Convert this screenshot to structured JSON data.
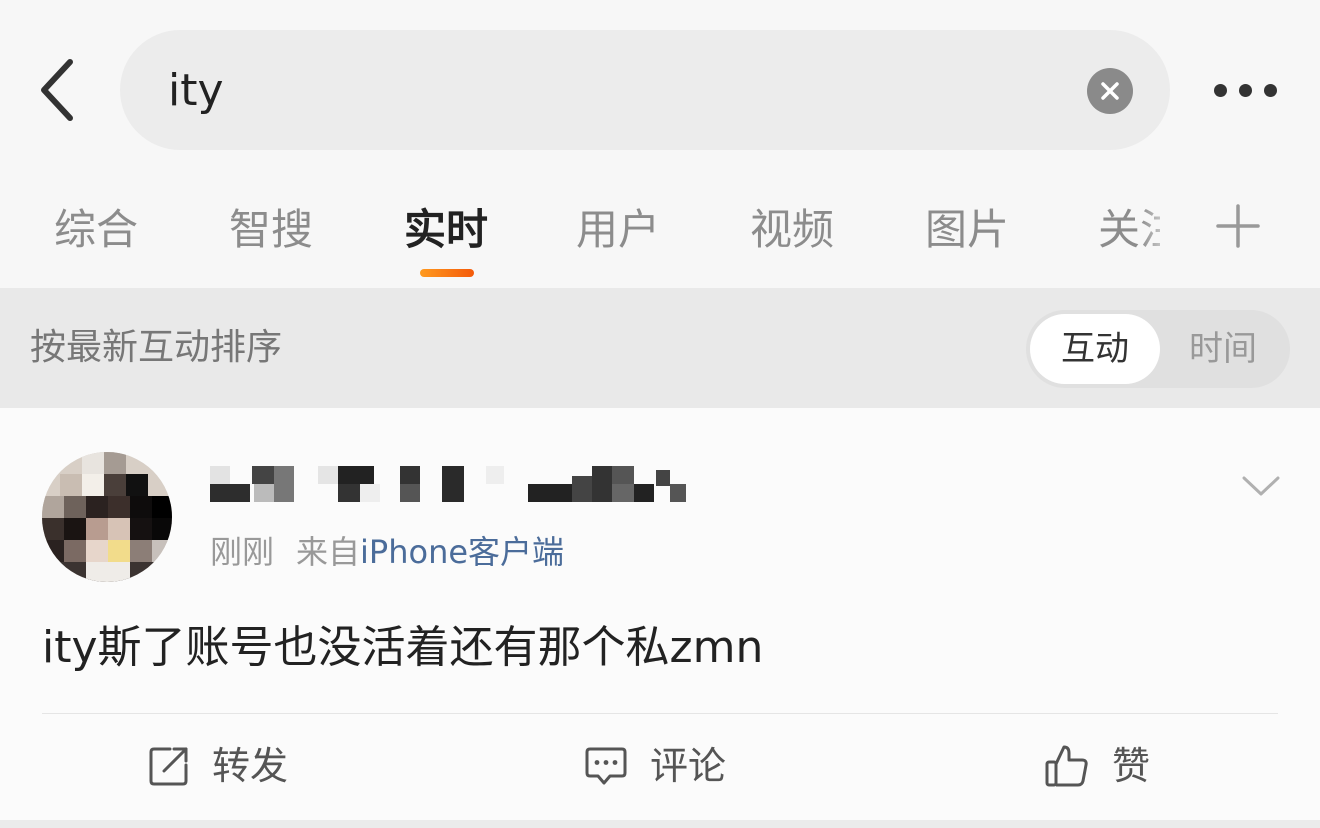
{
  "search": {
    "query": "ity"
  },
  "tabs": [
    {
      "label": "综合",
      "active": false
    },
    {
      "label": "智搜",
      "active": false
    },
    {
      "label": "实时",
      "active": true
    },
    {
      "label": "用户",
      "active": false
    },
    {
      "label": "视频",
      "active": false
    },
    {
      "label": "图片",
      "active": false
    },
    {
      "label": "关注",
      "active": false
    }
  ],
  "sort": {
    "label": "按最新互动排序",
    "options": [
      "互动",
      "时间"
    ],
    "selected": "互动"
  },
  "post": {
    "time": "刚刚",
    "source_prefix": "来自",
    "source": "iPhone客户端",
    "text": "ity斯了账号也没活着还有那个私zmn"
  },
  "actions": {
    "repost": "转发",
    "comment": "评论",
    "like": "赞"
  },
  "colors": {
    "accent": "#ff8200",
    "source_link": "#4b6c9a"
  },
  "icons": [
    "back-icon",
    "clear-icon",
    "more-icon",
    "add-icon",
    "chevron-down-icon",
    "repost-icon",
    "comment-icon",
    "like-icon"
  ]
}
